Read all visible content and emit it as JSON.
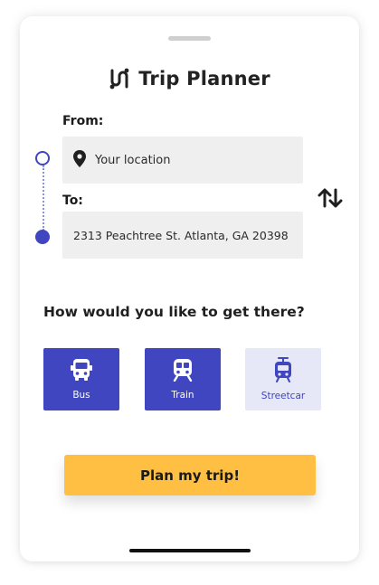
{
  "app": {
    "title": "Trip Planner",
    "logo_icon": "route-logo-icon",
    "accent_color": "#3f46c0",
    "cta_color": "#ffbf42"
  },
  "route": {
    "from_label": "From:",
    "from_value": "Your location",
    "from_icon": "map-pin-icon",
    "to_label": "To:",
    "to_value": "2313 Peachtree St. Atlanta, GA 20398",
    "swap_icon": "swap-vertical-icon"
  },
  "transport": {
    "question": "How would you like to get there?",
    "modes": [
      {
        "label": "Bus",
        "icon": "bus-icon",
        "selected": true
      },
      {
        "label": "Train",
        "icon": "train-icon",
        "selected": true
      },
      {
        "label": "Streetcar",
        "icon": "streetcar-icon",
        "selected": false
      }
    ]
  },
  "actions": {
    "plan_label": "Plan my trip!"
  }
}
